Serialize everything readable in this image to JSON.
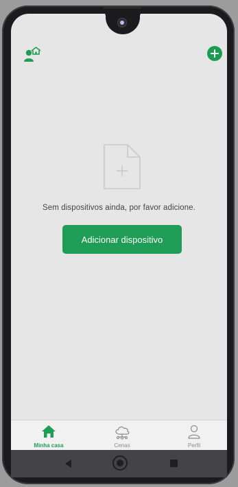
{
  "empty_state": {
    "message": "Sem dispositivos ainda, por favor adicione.",
    "icon": "document-add-icon"
  },
  "actions": {
    "add_device_label": "Adicionar dispositivo"
  },
  "header": {
    "left_icon": "home-user-icon",
    "right_icon": "plus-circle-icon"
  },
  "tabs": [
    {
      "label": "Minha casa",
      "icon": "house-icon",
      "active": true
    },
    {
      "label": "Cenas",
      "icon": "cloud-scenes-icon",
      "active": false
    },
    {
      "label": "Perfil",
      "icon": "person-icon",
      "active": false
    }
  ],
  "system_nav": [
    "back",
    "home",
    "recents"
  ],
  "colors": {
    "accent": "#1f9c55",
    "screen_bg": "#e6e6e6",
    "inactive_tab": "#8a8a8a"
  }
}
